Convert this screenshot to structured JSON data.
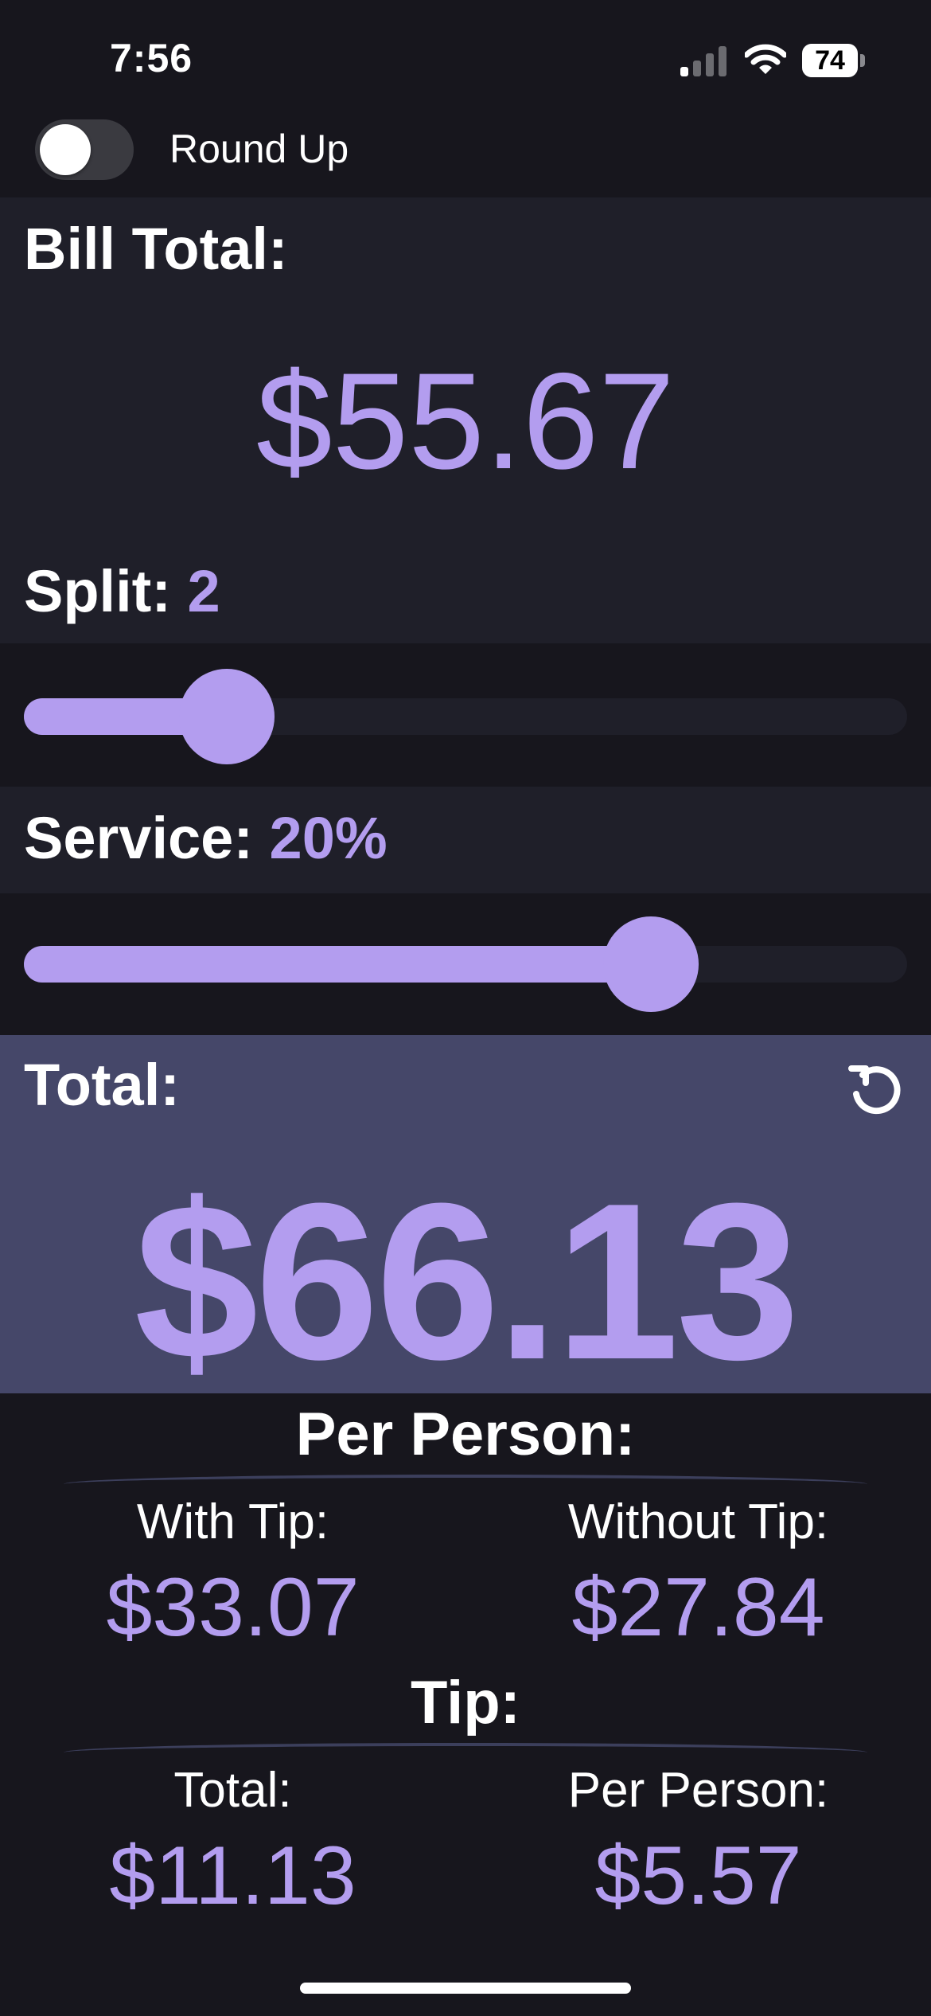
{
  "status_bar": {
    "time": "7:56",
    "battery": "74"
  },
  "round_up": {
    "label": "Round Up",
    "enabled": false
  },
  "bill": {
    "label": "Bill Total:",
    "amount": "$55.67"
  },
  "split": {
    "label": "Split:",
    "value": "2",
    "slider_fraction": 0.23
  },
  "service": {
    "label": "Service:",
    "value": "20%",
    "slider_fraction": 0.71
  },
  "total": {
    "label": "Total:",
    "amount": "$66.13"
  },
  "per_person": {
    "title": "Per Person:",
    "with_tip_label": "With Tip:",
    "with_tip_value": "$33.07",
    "without_tip_label": "Without Tip:",
    "without_tip_value": "$27.84"
  },
  "tip": {
    "title": "Tip:",
    "total_label": "Total:",
    "total_value": "$11.13",
    "per_person_label": "Per Person:",
    "per_person_value": "$5.57"
  },
  "icons": {
    "reset": "reset-icon",
    "signal": "cellular-signal-icon",
    "wifi": "wifi-icon",
    "battery": "battery-icon"
  },
  "colors": {
    "accent": "#b39def",
    "background": "#17161d",
    "panel": "#1f1f29",
    "total_panel": "#454769"
  }
}
